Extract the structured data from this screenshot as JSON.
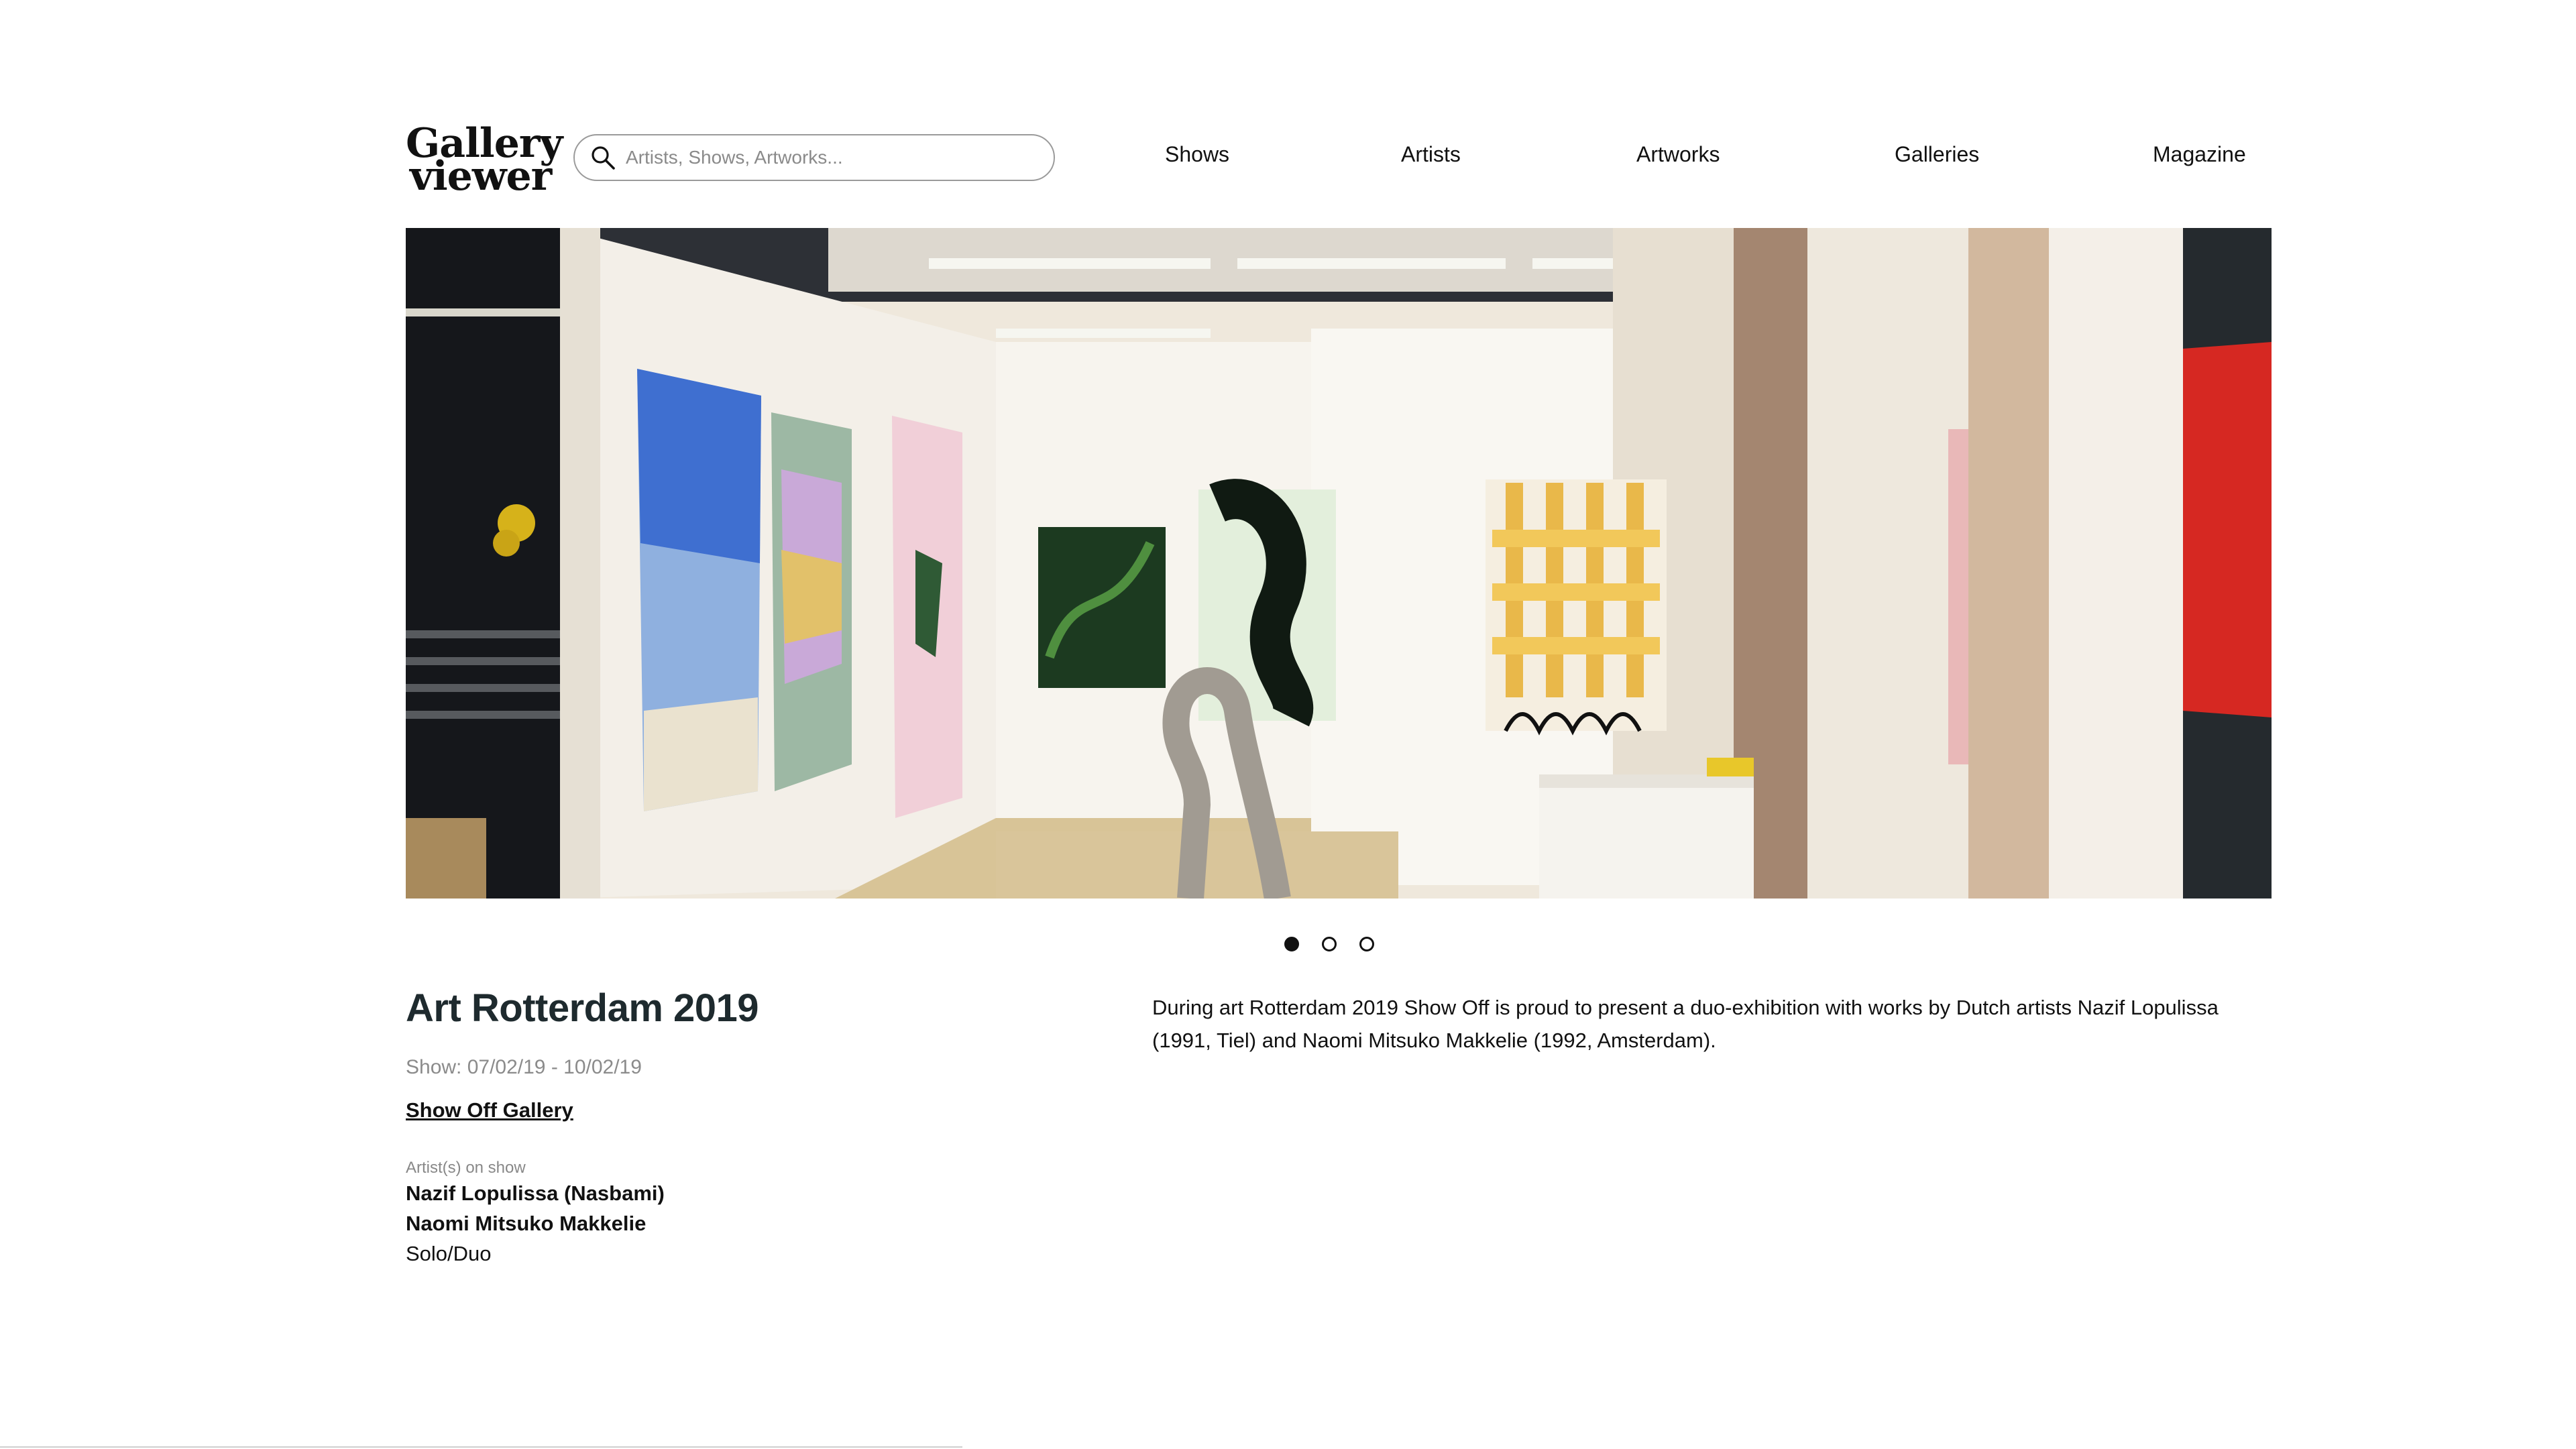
{
  "header": {
    "logo_line1": "Gallery",
    "logo_line2": "viewer",
    "search_placeholder": "Artists, Shows, Artworks..."
  },
  "nav": {
    "items": [
      "Shows",
      "Artists",
      "Artworks",
      "Galleries",
      "Magazine"
    ]
  },
  "carousel": {
    "slide_count": 3,
    "active_index": 0
  },
  "show": {
    "title": "Art Rotterdam 2019",
    "dates": "Show: 07/02/19 - 10/02/19",
    "gallery": "Show Off Gallery",
    "artists_label": "Artist(s) on show",
    "artists": [
      "Nazif Lopulissa (Nasbami)",
      "Naomi Mitsuko Makkelie"
    ],
    "show_type": "Solo/Duo",
    "description": "During art Rotterdam 2019 Show Off is proud to present a duo-exhibition with works by Dutch artists Nazif Lopulissa (1991, Tiel) and Naomi Mitsuko Makkelie (1992, Amsterdam)."
  },
  "colors": {
    "title": "#1e2a2e",
    "muted": "#8b8b8b",
    "search_border": "#9a9a9a"
  }
}
